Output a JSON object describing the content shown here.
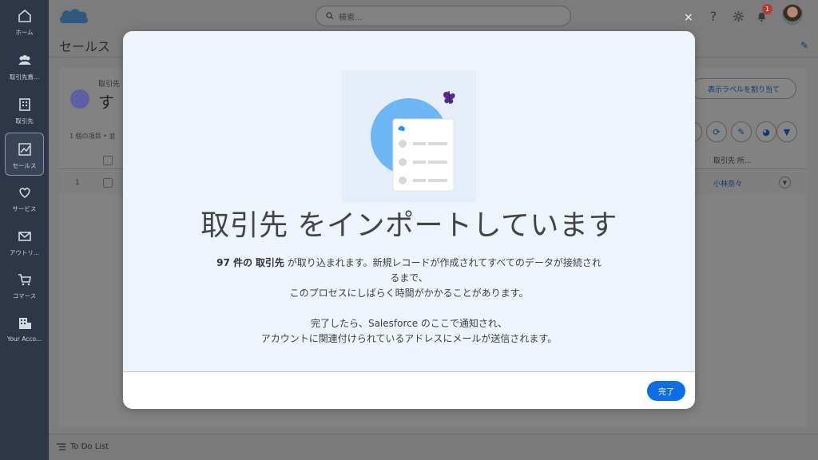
{
  "sidebar": {
    "items": [
      {
        "label": "ホーム",
        "icon": "home-icon"
      },
      {
        "label": "取引先責...",
        "icon": "contacts-icon"
      },
      {
        "label": "取引先",
        "icon": "building-icon"
      },
      {
        "label": "セールス",
        "icon": "chart-icon",
        "active": true
      },
      {
        "label": "サービス",
        "icon": "heart-icon"
      },
      {
        "label": "アウトリ...",
        "icon": "envelope-icon"
      },
      {
        "label": "コマース",
        "icon": "cart-icon"
      },
      {
        "label": "Your Acco...",
        "icon": "office-icon"
      }
    ]
  },
  "header": {
    "search_placeholder": "検索...",
    "notification_count": "1",
    "help_icon": "?"
  },
  "app": {
    "title": "セールス",
    "breadcrumb": "取引先",
    "list_title": "す",
    "list_meta": "1 個の項目 • 並",
    "assign_label": "表示ラベルを割り当て",
    "column_owner": "取引先 所...",
    "row_number": "1",
    "row_owner": "小林奈々",
    "todo": "To Do List"
  },
  "modal": {
    "title": "取引先 をインポートしています",
    "line1_count": "97 件の",
    "line1_object": "取引先",
    "line1_rest": "が取り込まれます。新規レコードが作成されてすべてのデータが接続さ",
    "line1_tail": "れ",
    "line2": "るまで、",
    "line3": "このプロセスにしばらく時間がかかることがあります。",
    "line4": "完了したら、Salesforce のここで通知され、",
    "line5": "アカウントに関連付けられているアドレスにメールが送信されます。",
    "done_label": "完了",
    "close": "×"
  },
  "colors": {
    "primary": "#0b6ee6",
    "modal_body_bg": "#eef4fc",
    "sidebar_bg": "#2d3748",
    "illustration_circle": "#6cb6f5",
    "butterfly": "#5a2a8c"
  }
}
